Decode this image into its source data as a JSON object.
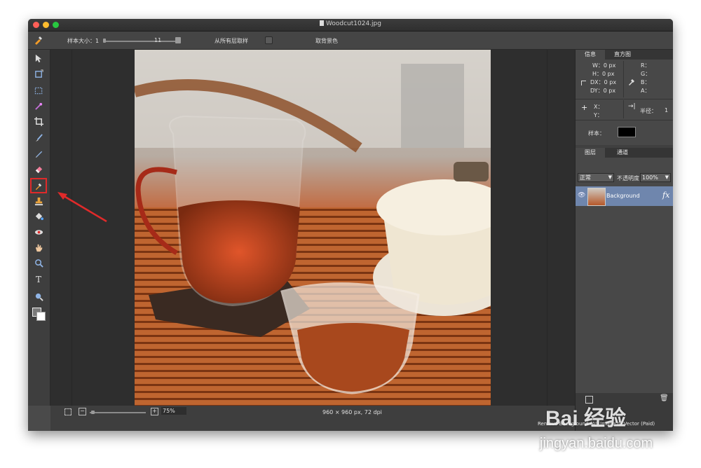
{
  "window": {
    "title": "Woodcut1024.jpg"
  },
  "options_bar": {
    "sample_size_label": "样本大小：1",
    "sample_size_value": "11",
    "sample_all_layers_label": "从所有层取样",
    "take_bg_label": "取背景色"
  },
  "tools": [
    {
      "name": "move-icon"
    },
    {
      "name": "artboard-icon"
    },
    {
      "name": "marquee-icon"
    },
    {
      "name": "magic-wand-icon"
    },
    {
      "name": "crop-icon"
    },
    {
      "name": "brush-icon"
    },
    {
      "name": "pencil-icon"
    },
    {
      "name": "eraser-icon"
    },
    {
      "name": "eyedropper-icon"
    },
    {
      "name": "stamp-icon"
    },
    {
      "name": "paint-bucket-icon"
    },
    {
      "name": "eye-icon"
    },
    {
      "name": "hand-icon"
    },
    {
      "name": "zoom-icon"
    },
    {
      "name": "text-icon"
    },
    {
      "name": "magnifier-icon"
    },
    {
      "name": "color-swatches-icon"
    }
  ],
  "info_panel": {
    "tabs": [
      "信息",
      "直方图"
    ],
    "w": "W：0 px",
    "h": "H：0 px",
    "dx": "DX：0 px",
    "dy": "DY：0 px",
    "r": "R：",
    "g": "G：",
    "b": "B：",
    "a": "A：",
    "x": "X：",
    "y": "Y：",
    "radius_label": "半径：",
    "radius_value": "1",
    "sample_label": "样本："
  },
  "layers_panel": {
    "tabs": [
      "图层",
      "通道"
    ],
    "blend_mode": "正常",
    "opacity_label": "不透明度",
    "opacity_value": "100%",
    "fx_label": "fx",
    "layers": [
      {
        "name": "Background",
        "fx": "fx"
      }
    ]
  },
  "status": {
    "zoom": "75%",
    "dimensions": "960 × 960 px, 72 dpi"
  },
  "bottom_plugin": {
    "text": "Remove Background (AI)   Image to Vector (Paid)"
  },
  "watermark": {
    "logo": "Bai 经验",
    "url": "jingyan.baidu.com"
  },
  "colors": {
    "accent_selection": "#e02a2a",
    "layer_selected": "#6f86ad",
    "arrow": "#e02a2a"
  }
}
